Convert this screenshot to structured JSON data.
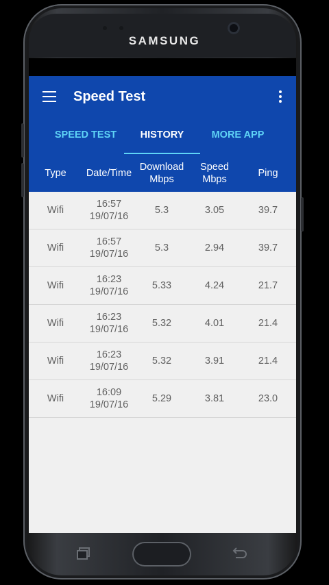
{
  "device": {
    "brand": "SAMSUNG"
  },
  "appbar": {
    "title": "Speed Test",
    "menu_icon": "hamburger-menu-icon",
    "overflow_icon": "more-vert-icon"
  },
  "tabs": [
    {
      "label": "SPEED TEST",
      "active": false
    },
    {
      "label": "HISTORY",
      "active": true
    },
    {
      "label": "MORE APP",
      "active": false
    }
  ],
  "table": {
    "headers": [
      "Type",
      "Date/Time",
      "Download\nMbps",
      "Speed\nMbps",
      "Ping"
    ],
    "rows": [
      {
        "type": "Wifi",
        "time": "16:57",
        "date": "19/07/16",
        "download": "5.3",
        "speed": "3.05",
        "ping": "39.7"
      },
      {
        "type": "Wifi",
        "time": "16:57",
        "date": "19/07/16",
        "download": "5.3",
        "speed": "2.94",
        "ping": "39.7"
      },
      {
        "type": "Wifi",
        "time": "16:23",
        "date": "19/07/16",
        "download": "5.33",
        "speed": "4.24",
        "ping": "21.7"
      },
      {
        "type": "Wifi",
        "time": "16:23",
        "date": "19/07/16",
        "download": "5.32",
        "speed": "4.01",
        "ping": "21.4"
      },
      {
        "type": "Wifi",
        "time": "16:23",
        "date": "19/07/16",
        "download": "5.32",
        "speed": "3.91",
        "ping": "21.4"
      },
      {
        "type": "Wifi",
        "time": "16:09",
        "date": "19/07/16",
        "download": "5.29",
        "speed": "3.81",
        "ping": "23.0"
      }
    ]
  },
  "colors": {
    "primary": "#0f47ad",
    "tab_inactive": "#5fd4f6",
    "table_bg": "#f0f0f0",
    "cell_text": "#606060"
  }
}
